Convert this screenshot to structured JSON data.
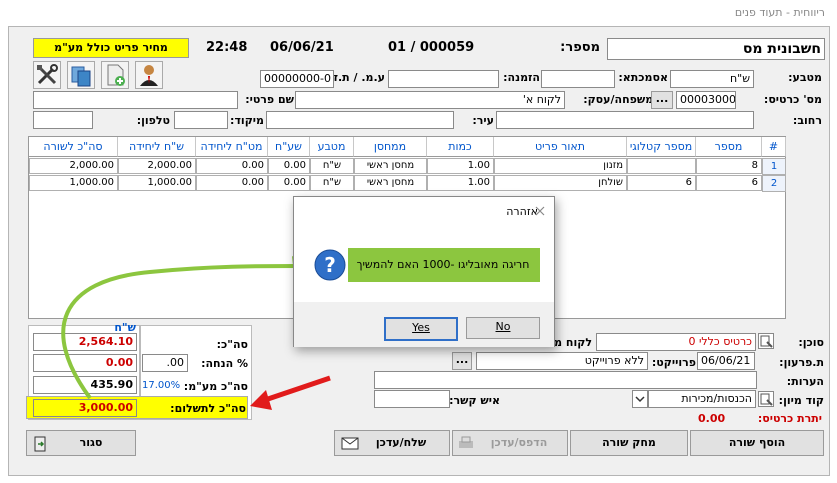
{
  "window": {
    "title": "ריווחית - תעוד פנים"
  },
  "header": {
    "doc_type": "חשבונית מס",
    "number_label": "מספר:",
    "number_value": "01 / 000059",
    "date": "06/06/21",
    "time": "22:48",
    "price_incl_vat": "מחיר פריט כולל מע\"מ"
  },
  "form": {
    "currency_label": "מטבע:",
    "currency_value": "ש\"ח",
    "reference_label": "אסמכתא:",
    "reference_value": "",
    "order_label": "הזמנה:",
    "order_value": "",
    "vat_id_label": "ע.מ. / ת.ז:",
    "vat_id_value": "00000000-0",
    "card_no_label": "מס' כרטיס:",
    "card_no_value": "00003000",
    "ellipsis": "...",
    "family_label": "שם משפחה/עסק:",
    "family_value": "לקוח א'",
    "first_name_label": "שם פרטי:",
    "first_name_value": "",
    "street_label": "רחוב:",
    "street_value": "",
    "city_label": "עיר:",
    "city_value": "",
    "zip_label": "מיקוד:",
    "zip_value": "",
    "phone_label": "טלפון:",
    "phone_value": ""
  },
  "grid": {
    "columns": [
      "#",
      "מספר",
      "מספר קטלוגי",
      "תאור פריט",
      "כמות",
      "ממחסן",
      "מטבע",
      "שע\"ח",
      "מט\"ח ליחידה",
      "ש\"ח ליחידה",
      "סה\"כ לשורה"
    ],
    "rows": [
      {
        "idx": "1",
        "num": "8",
        "catalog": "",
        "desc": "מזנון",
        "qty": "1.00",
        "warehouse": "מחסן ראשי",
        "currency": "ש\"ח",
        "rate": "0.00",
        "fx_unit": "0.00",
        "ils_unit": "2,000.00",
        "total": "2,000.00"
      },
      {
        "idx": "2",
        "num": "6",
        "catalog": "6",
        "desc": "שולחן",
        "qty": "1.00",
        "warehouse": "מחסן ראשי",
        "currency": "ש\"ח",
        "rate": "0.00",
        "fx_unit": "0.00",
        "ils_unit": "1,000.00",
        "total": "1,000.00"
      }
    ]
  },
  "totals": {
    "currency": "ש\"ח",
    "sum_label": "סה\"כ:",
    "sum_value": "2,564.10",
    "discount_label": "% הנחה:",
    "discount_pct": ".00",
    "discount_value": "0.00",
    "vat_label": "סה\"כ מע\"מ:",
    "vat_rate": "17.00%",
    "vat_value": "435.90",
    "grand_label": "סה\"כ לתשלום:",
    "grand_value": "3,000.00"
  },
  "side": {
    "agent_label": "סוכן:",
    "agent_value": "כרטיס כללי 0",
    "customer_label": "לקוח מ",
    "due_label": "ת.פרעון:",
    "due_value": "06/06/21",
    "project_label": "פרוייקט:",
    "project_value": "ללא פרוייקט",
    "notes_label": "הערות:",
    "notes_value": "",
    "sort_code_label": "קוד מיון:",
    "sort_code_value": "הכנסות/מכירות",
    "contact_label": "איש קשר:",
    "contact_value": "",
    "balance_label": "יתרת כרטיס:",
    "balance_value": "0.00"
  },
  "buttons": {
    "add_row": "הוסף שורה",
    "delete_row": "מחק שורה",
    "print": "הדפס/עדכן",
    "send": "שלח/עדכן",
    "close": "סגור"
  },
  "dialog": {
    "title": "אזהרה",
    "message": "חריגה מאובליגו -1000 האם להמשיך",
    "yes": "Yes",
    "no": "No"
  },
  "colors": {
    "highlight_yellow": "#ffff00",
    "dialog_green": "#8cc63f",
    "arrow_red": "#e11b1b",
    "value_red": "#cc0000",
    "link_blue": "#0055cc"
  }
}
